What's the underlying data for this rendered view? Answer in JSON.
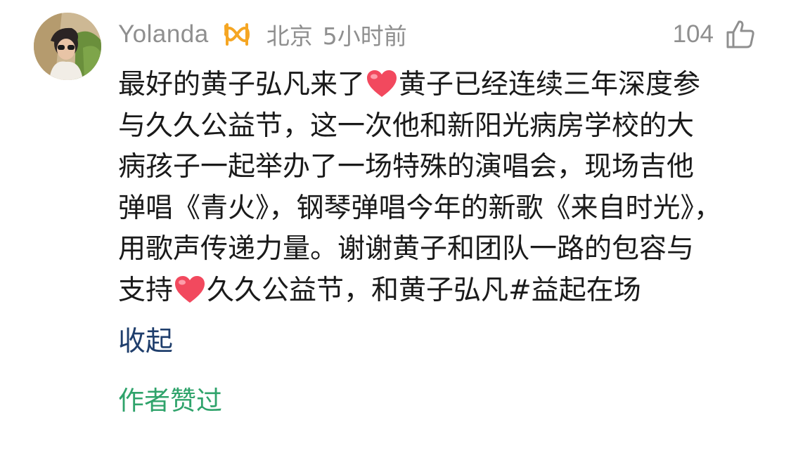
{
  "comment": {
    "author": {
      "name": "Yolanda",
      "location": "北京",
      "time": "5小时前"
    },
    "like_count": "104",
    "text_lines": [
      [
        "最好的黄子弘凡来了",
        "heart",
        "黄子已经连续三年深度参"
      ],
      [
        "与久久公益节，这一次他和新阳光病房学校的大"
      ],
      [
        "病孩子一起举办了一场特殊的演唱会，现场吉他"
      ],
      [
        "弹唱《青火》，钢琴弹唱今年的新歌《来自时光》，"
      ],
      [
        "用歌声传递力量。谢谢黄子和团队一路的包容与"
      ],
      [
        "支持",
        "heart",
        "久久公益节，和黄子弘凡#益起在场"
      ]
    ],
    "collapse_label": "收起",
    "author_liked_label": "作者赞过"
  },
  "icons": {
    "badge": "vip-badge-icon",
    "like": "thumbs-up-icon",
    "inline": "heart-emoji-icon"
  },
  "colors": {
    "meta_gray": "#8f8f8f",
    "text": "#1a1a1a",
    "link_blue": "#1f3e6c",
    "liked_green": "#2fa36b",
    "badge_orange": "#f5a623",
    "heart_red": "#f2495e"
  }
}
